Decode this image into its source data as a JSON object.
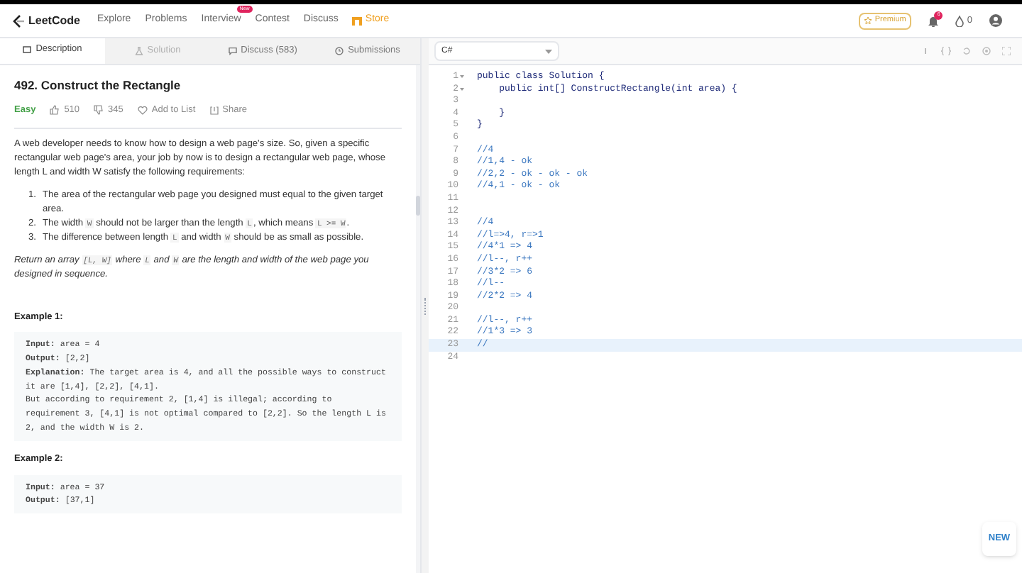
{
  "nav": {
    "brand": "LeetCode",
    "links": [
      {
        "label": "Explore",
        "kind": "link"
      },
      {
        "label": "Problems",
        "kind": "link"
      },
      {
        "label": "Interview",
        "kind": "link",
        "badge": "New"
      },
      {
        "label": "Contest",
        "kind": "link"
      },
      {
        "label": "Discuss",
        "kind": "link"
      },
      {
        "label": "Store",
        "kind": "store"
      }
    ],
    "premium": "Premium",
    "notifications": "6",
    "coins": "0"
  },
  "tabs": [
    {
      "label": "Description",
      "selected": true,
      "disabled": false
    },
    {
      "label": "Solution",
      "selected": false,
      "disabled": true
    },
    {
      "label": "Discuss (583)",
      "selected": false,
      "disabled": false
    },
    {
      "label": "Submissions",
      "selected": false,
      "disabled": false
    }
  ],
  "language": "C#",
  "problem": {
    "title": "492. Construct the Rectangle",
    "difficulty": "Easy",
    "likes": "510",
    "dislikes": "345",
    "add_to_list": "Add to List",
    "share": "Share",
    "intro": "A web developer needs to know how to design a web page's size. So, given a specific rectangular web page's area, your job by now is to design a rectangular web page, whose length L and width W satisfy the following requirements:",
    "requirements": [
      {
        "marker": "1.",
        "segments": [
          {
            "kind": "text",
            "text": "The area of the rectangular web page you designed must equal to the given target area."
          }
        ]
      },
      {
        "marker": "2.",
        "segments": [
          {
            "kind": "text",
            "text": "The width "
          },
          {
            "kind": "code",
            "text": "W"
          },
          {
            "kind": "text",
            "text": " should not be larger than the length "
          },
          {
            "kind": "code",
            "text": "L"
          },
          {
            "kind": "text",
            "text": ", which means "
          },
          {
            "kind": "code",
            "text": "L >= W"
          },
          {
            "kind": "text",
            "text": "."
          }
        ]
      },
      {
        "marker": "3.",
        "segments": [
          {
            "kind": "text",
            "text": "The difference between length "
          },
          {
            "kind": "code",
            "text": "L"
          },
          {
            "kind": "text",
            "text": " and width "
          },
          {
            "kind": "code",
            "text": "W"
          },
          {
            "kind": "text",
            "text": " should be as small as possible."
          }
        ]
      }
    ],
    "return": [
      {
        "kind": "text",
        "text": "Return an array "
      },
      {
        "kind": "code",
        "text": "[L, W]"
      },
      {
        "kind": "text",
        "text": " where "
      },
      {
        "kind": "code",
        "text": "L"
      },
      {
        "kind": "text",
        "text": " and "
      },
      {
        "kind": "code",
        "text": "W"
      },
      {
        "kind": "text",
        "text": " are the length and width of the web page you designed in sequence."
      }
    ],
    "examples": [
      {
        "title": "Example 1:",
        "lines": [
          "**Input:** area = 4",
          "**Output:** [2,2]",
          "**Explanation:** The target area is 4, and all the possible ways to construct it are [1,4], [2,2], [4,1].",
          "But according to requirement 2, [1,4] is illegal; according to requirement 3,  [4,1] is not optimal compared to [2,2]. So the length L is 2, and the width W is 2."
        ]
      },
      {
        "title": "Example 2:",
        "lines": [
          "**Input:** area = 37",
          "**Output:** [37,1]"
        ]
      }
    ]
  },
  "code": [
    {
      "number": "1",
      "text": "public class Solution {",
      "kind": "code",
      "foldable": true,
      "active": false
    },
    {
      "number": "2",
      "text": "    public int[] ConstructRectangle(int area) {",
      "kind": "code",
      "foldable": true,
      "active": false
    },
    {
      "number": "3",
      "foldable": false,
      "active": false
    },
    {
      "number": "4",
      "text": "    }",
      "kind": "code",
      "foldable": false,
      "active": false
    },
    {
      "number": "5",
      "text": "}",
      "kind": "code",
      "foldable": false,
      "active": false
    },
    {
      "number": "6",
      "foldable": false,
      "active": false
    },
    {
      "number": "7",
      "text": "//4",
      "kind": "comment",
      "foldable": false,
      "active": false
    },
    {
      "number": "8",
      "text": "//1,4 - ok",
      "kind": "comment",
      "foldable": false,
      "active": false
    },
    {
      "number": "9",
      "text": "//2,2 - ok - ok - ok",
      "kind": "comment",
      "foldable": false,
      "active": false
    },
    {
      "number": "10",
      "text": "//4,1 - ok - ok",
      "kind": "comment",
      "foldable": false,
      "active": false
    },
    {
      "number": "11",
      "foldable": false,
      "active": false
    },
    {
      "number": "12",
      "foldable": false,
      "active": false
    },
    {
      "number": "13",
      "text": "//4",
      "kind": "comment",
      "foldable": false,
      "active": false
    },
    {
      "number": "14",
      "text": "//l=>4, r=>1",
      "kind": "comment",
      "foldable": false,
      "active": false
    },
    {
      "number": "15",
      "text": "//4*1 => 4",
      "kind": "comment",
      "foldable": false,
      "active": false
    },
    {
      "number": "16",
      "text": "//l--, r++",
      "kind": "comment",
      "foldable": false,
      "active": false
    },
    {
      "number": "17",
      "text": "//3*2 => 6",
      "kind": "comment",
      "foldable": false,
      "active": false
    },
    {
      "number": "18",
      "text": "//l--",
      "kind": "comment",
      "foldable": false,
      "active": false
    },
    {
      "number": "19",
      "text": "//2*2 => 4",
      "kind": "comment",
      "foldable": false,
      "active": false
    },
    {
      "number": "20",
      "foldable": false,
      "active": false
    },
    {
      "number": "21",
      "text": "//l--, r++",
      "kind": "comment",
      "foldable": false,
      "active": false
    },
    {
      "number": "22",
      "text": "//1*3 => 3",
      "kind": "comment",
      "foldable": false,
      "active": false
    },
    {
      "number": "23",
      "text": "//",
      "kind": "comment",
      "foldable": false,
      "active": true
    },
    {
      "number": "24",
      "foldable": false,
      "active": false
    }
  ],
  "new_button": "NEW"
}
